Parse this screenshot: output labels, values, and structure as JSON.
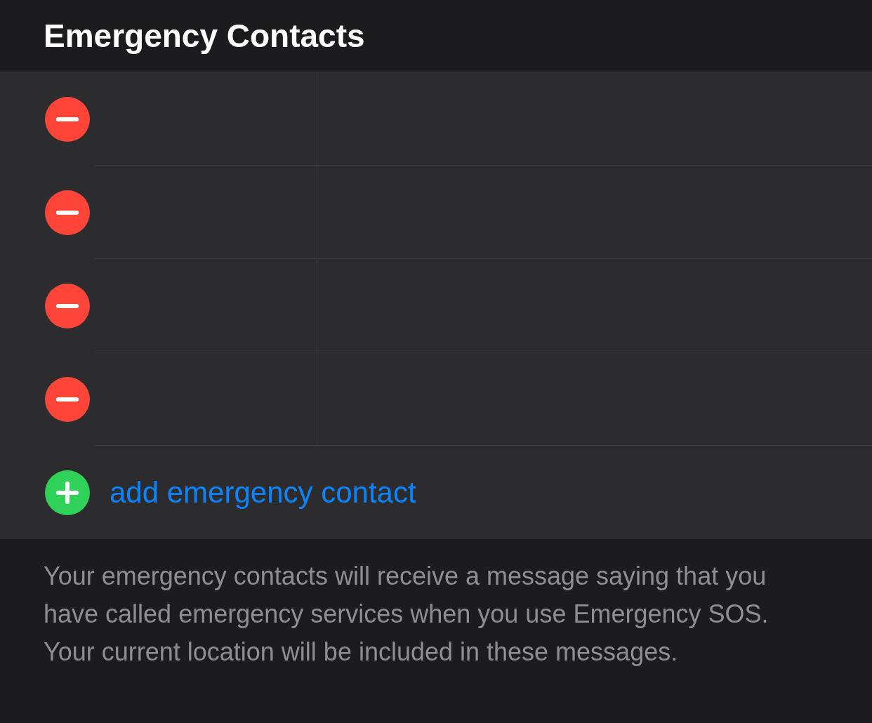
{
  "header": {
    "title": "Emergency Contacts"
  },
  "rows": [
    {
      "kind": "remove"
    },
    {
      "kind": "remove"
    },
    {
      "kind": "remove"
    },
    {
      "kind": "remove"
    },
    {
      "kind": "add",
      "label": "add emergency contact"
    }
  ],
  "footer": {
    "text": "Your emergency contacts will receive a message saying that you have called emergency services when you use Emergency SOS. Your current location will be included in these messages."
  }
}
